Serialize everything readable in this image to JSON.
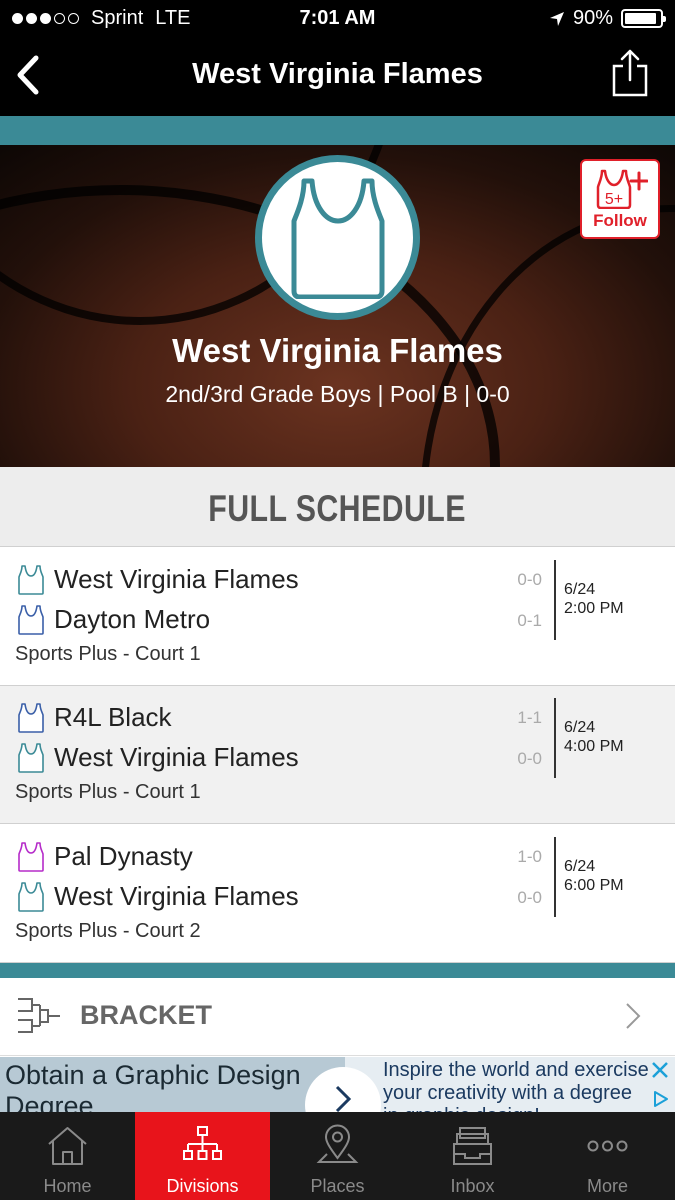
{
  "status_bar": {
    "carrier": "Sprint",
    "network": "LTE",
    "time": "7:01 AM",
    "battery": "90%",
    "battery_level": 0.9
  },
  "nav": {
    "title": "West Virginia Flames"
  },
  "hero": {
    "team_name": "West Virginia Flames",
    "subtitle": "2nd/3rd Grade Boys | Pool B | 0-0",
    "follow_badge": "5+",
    "follow_label": "Follow"
  },
  "schedule": {
    "heading": "FULL SCHEDULE",
    "games": [
      {
        "team1": "West Virginia Flames",
        "team1_record": "0-0",
        "team1_color": "#3b8a96",
        "team2": "Dayton Metro",
        "team2_record": "0-1",
        "team2_color": "#3a5fa8",
        "date": "6/24",
        "time": "2:00 PM",
        "court": "Sports Plus - Court 1"
      },
      {
        "team1": "R4L Black",
        "team1_record": "1-1",
        "team1_color": "#3a5fa8",
        "team2": "West Virginia Flames",
        "team2_record": "0-0",
        "team2_color": "#3b8a96",
        "date": "6/24",
        "time": "4:00 PM",
        "court": "Sports Plus - Court 1"
      },
      {
        "team1": "Pal Dynasty",
        "team1_record": "1-0",
        "team1_color": "#b52bc9",
        "team2": "West Virginia Flames",
        "team2_record": "0-0",
        "team2_color": "#3b8a96",
        "date": "6/24",
        "time": "6:00 PM",
        "court": "Sports Plus - Court 2"
      }
    ]
  },
  "bracket": {
    "label": "BRACKET"
  },
  "ad": {
    "title": "Obtain a Graphic Design Degree",
    "text": "Inspire the world and exercise your creativity with a degree in graphic design!"
  },
  "tabs": [
    {
      "label": "Home",
      "icon": "home-icon"
    },
    {
      "label": "Divisions",
      "icon": "divisions-icon"
    },
    {
      "label": "Places",
      "icon": "places-icon"
    },
    {
      "label": "Inbox",
      "icon": "inbox-icon"
    },
    {
      "label": "More",
      "icon": "more-icon"
    }
  ],
  "colors": {
    "accent_teal": "#3b8a96",
    "active_tab": "#e8141b",
    "follow_red": "#e0202a"
  }
}
